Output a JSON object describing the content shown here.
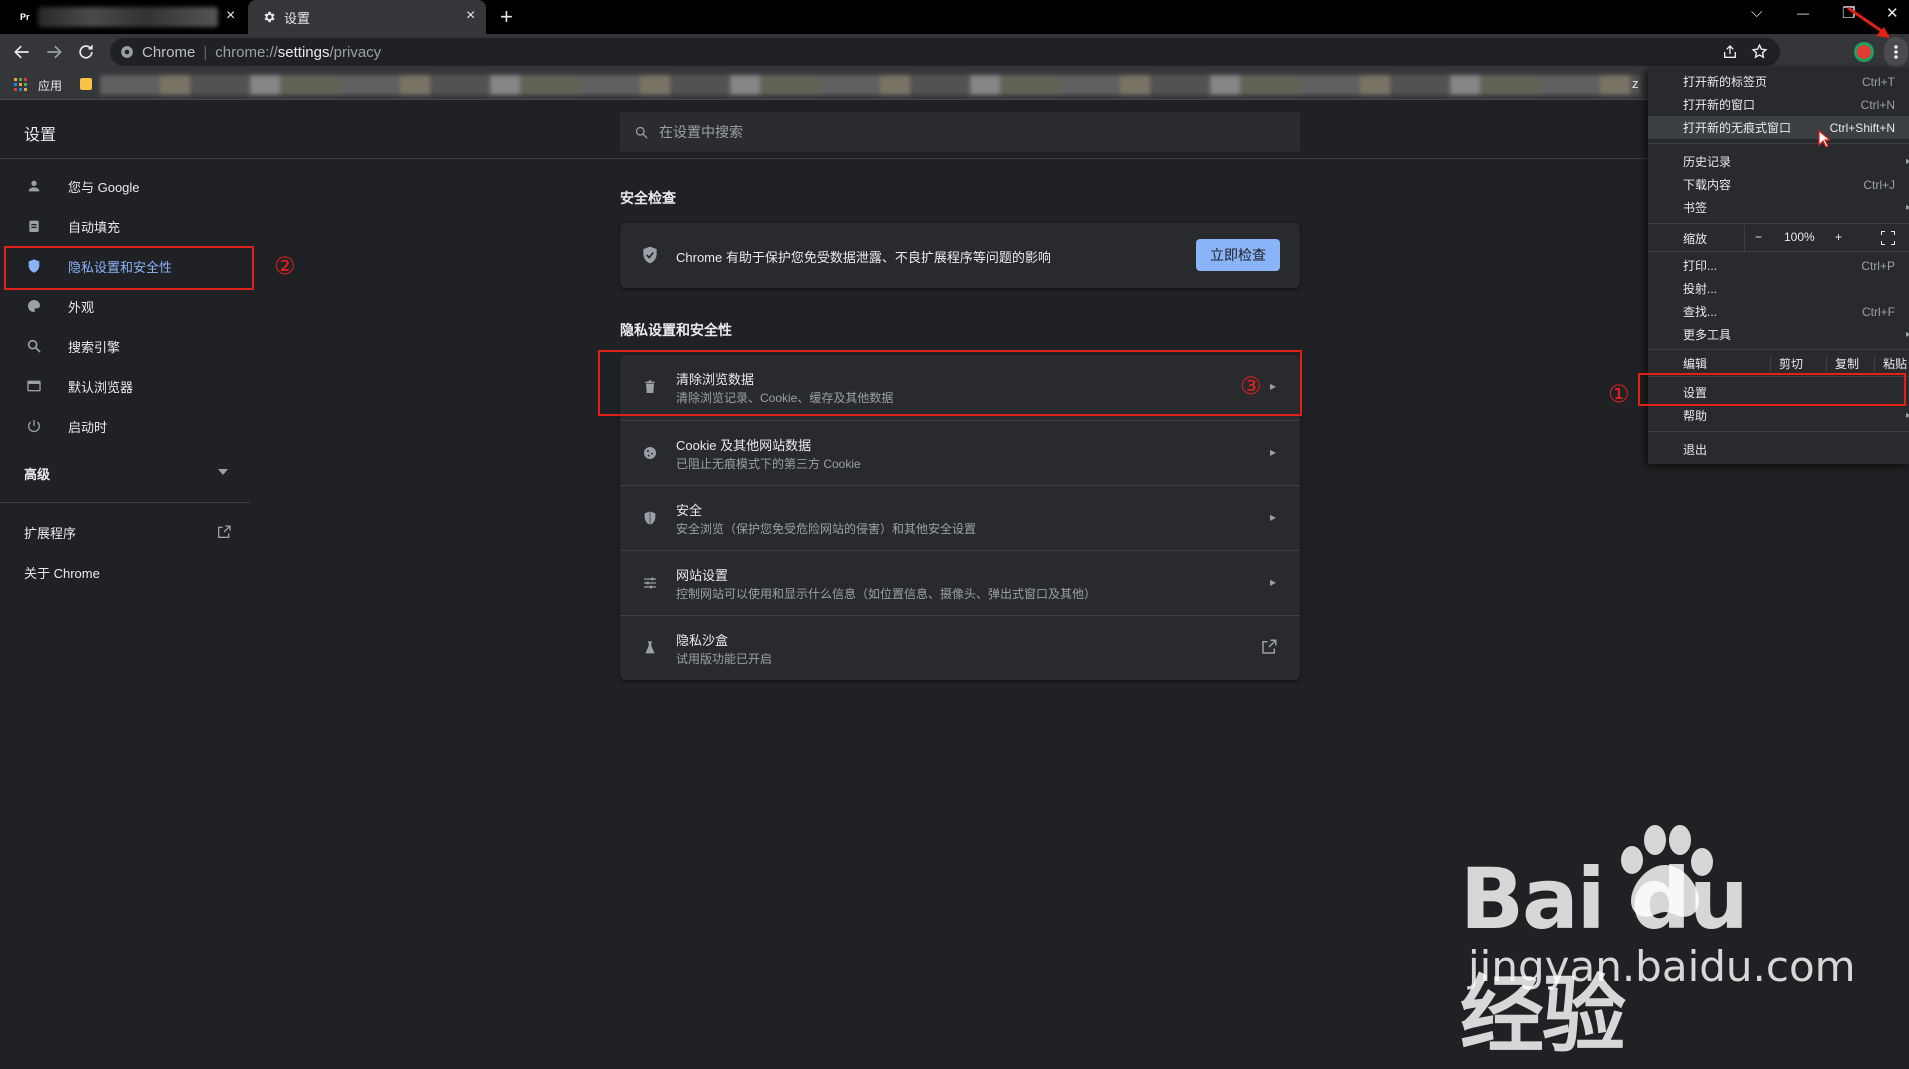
{
  "tabs": [
    {
      "label": "Pr",
      "close": "×"
    },
    {
      "label": "设置",
      "close": "×"
    }
  ],
  "new_tab": "+",
  "window_controls": {
    "dropdown": "⌵",
    "minimize": "—",
    "restore": "❐",
    "close": "✕"
  },
  "omnibox": {
    "site": "Chrome",
    "url_prefix": "chrome://",
    "url_bold": "settings",
    "url_suffix": "/privacy"
  },
  "bookmarks": {
    "apps_label": "应用",
    "trailing": "z"
  },
  "settings": {
    "title": "设置",
    "search_placeholder": "在设置中搜索"
  },
  "nav": {
    "items": [
      {
        "label": "您与 Google",
        "icon": "person-icon"
      },
      {
        "label": "自动填充",
        "icon": "clipboard-icon"
      },
      {
        "label": "隐私设置和安全性",
        "icon": "shield-icon",
        "active": true
      },
      {
        "label": "外观",
        "icon": "palette-icon"
      },
      {
        "label": "搜索引擎",
        "icon": "search-icon"
      },
      {
        "label": "默认浏览器",
        "icon": "browser-icon"
      },
      {
        "label": "启动时",
        "icon": "power-icon"
      }
    ],
    "advanced": "高级",
    "extensions": "扩展程序",
    "about": "关于 Chrome"
  },
  "safety_check": {
    "section_title": "安全检查",
    "text": "Chrome 有助于保护您免受数据泄露、不良扩展程序等问题的影响",
    "button": "立即检查"
  },
  "privacy": {
    "section_title": "隐私设置和安全性",
    "rows": [
      {
        "title": "清除浏览数据",
        "subtitle": "清除浏览记录、Cookie、缓存及其他数据",
        "icon": "trash-icon"
      },
      {
        "title": "Cookie 及其他网站数据",
        "subtitle": "已阻止无痕模式下的第三方 Cookie",
        "icon": "cookie-icon"
      },
      {
        "title": "安全",
        "subtitle": "安全浏览（保护您免受危险网站的侵害）和其他安全设置",
        "icon": "shield-icon"
      },
      {
        "title": "网站设置",
        "subtitle": "控制网站可以使用和显示什么信息（如位置信息、摄像头、弹出式窗口及其他）",
        "icon": "sliders-icon"
      },
      {
        "title": "隐私沙盒",
        "subtitle": "试用版功能已开启",
        "icon": "flask-icon"
      }
    ]
  },
  "menu": {
    "new_tab": {
      "label": "打开新的标签页",
      "shortcut": "Ctrl+T"
    },
    "new_window": {
      "label": "打开新的窗口",
      "shortcut": "Ctrl+N"
    },
    "incognito": {
      "label": "打开新的无痕式窗口",
      "shortcut": "Ctrl+Shift+N"
    },
    "history": {
      "label": "历史记录"
    },
    "downloads": {
      "label": "下载内容",
      "shortcut": "Ctrl+J"
    },
    "bookmarks": {
      "label": "书签"
    },
    "zoom": {
      "label": "缩放",
      "minus": "−",
      "value": "100%",
      "plus": "+"
    },
    "print": {
      "label": "打印...",
      "shortcut": "Ctrl+P"
    },
    "cast": {
      "label": "投射..."
    },
    "find": {
      "label": "查找...",
      "shortcut": "Ctrl+F"
    },
    "more_tools": {
      "label": "更多工具"
    },
    "edit": {
      "label": "编辑",
      "cut": "剪切",
      "copy": "复制",
      "paste": "粘贴"
    },
    "settings": {
      "label": "设置"
    },
    "help": {
      "label": "帮助"
    },
    "exit": {
      "label": "退出"
    }
  },
  "annotations": {
    "one": "①",
    "two": "②",
    "three": "③"
  },
  "colors": {
    "annotation": "#e0211a",
    "accent": "#8ab4f8",
    "background": "#202124"
  },
  "watermark": {
    "brand": "Bai du 经验",
    "url": "jingyan.baidu.com"
  }
}
